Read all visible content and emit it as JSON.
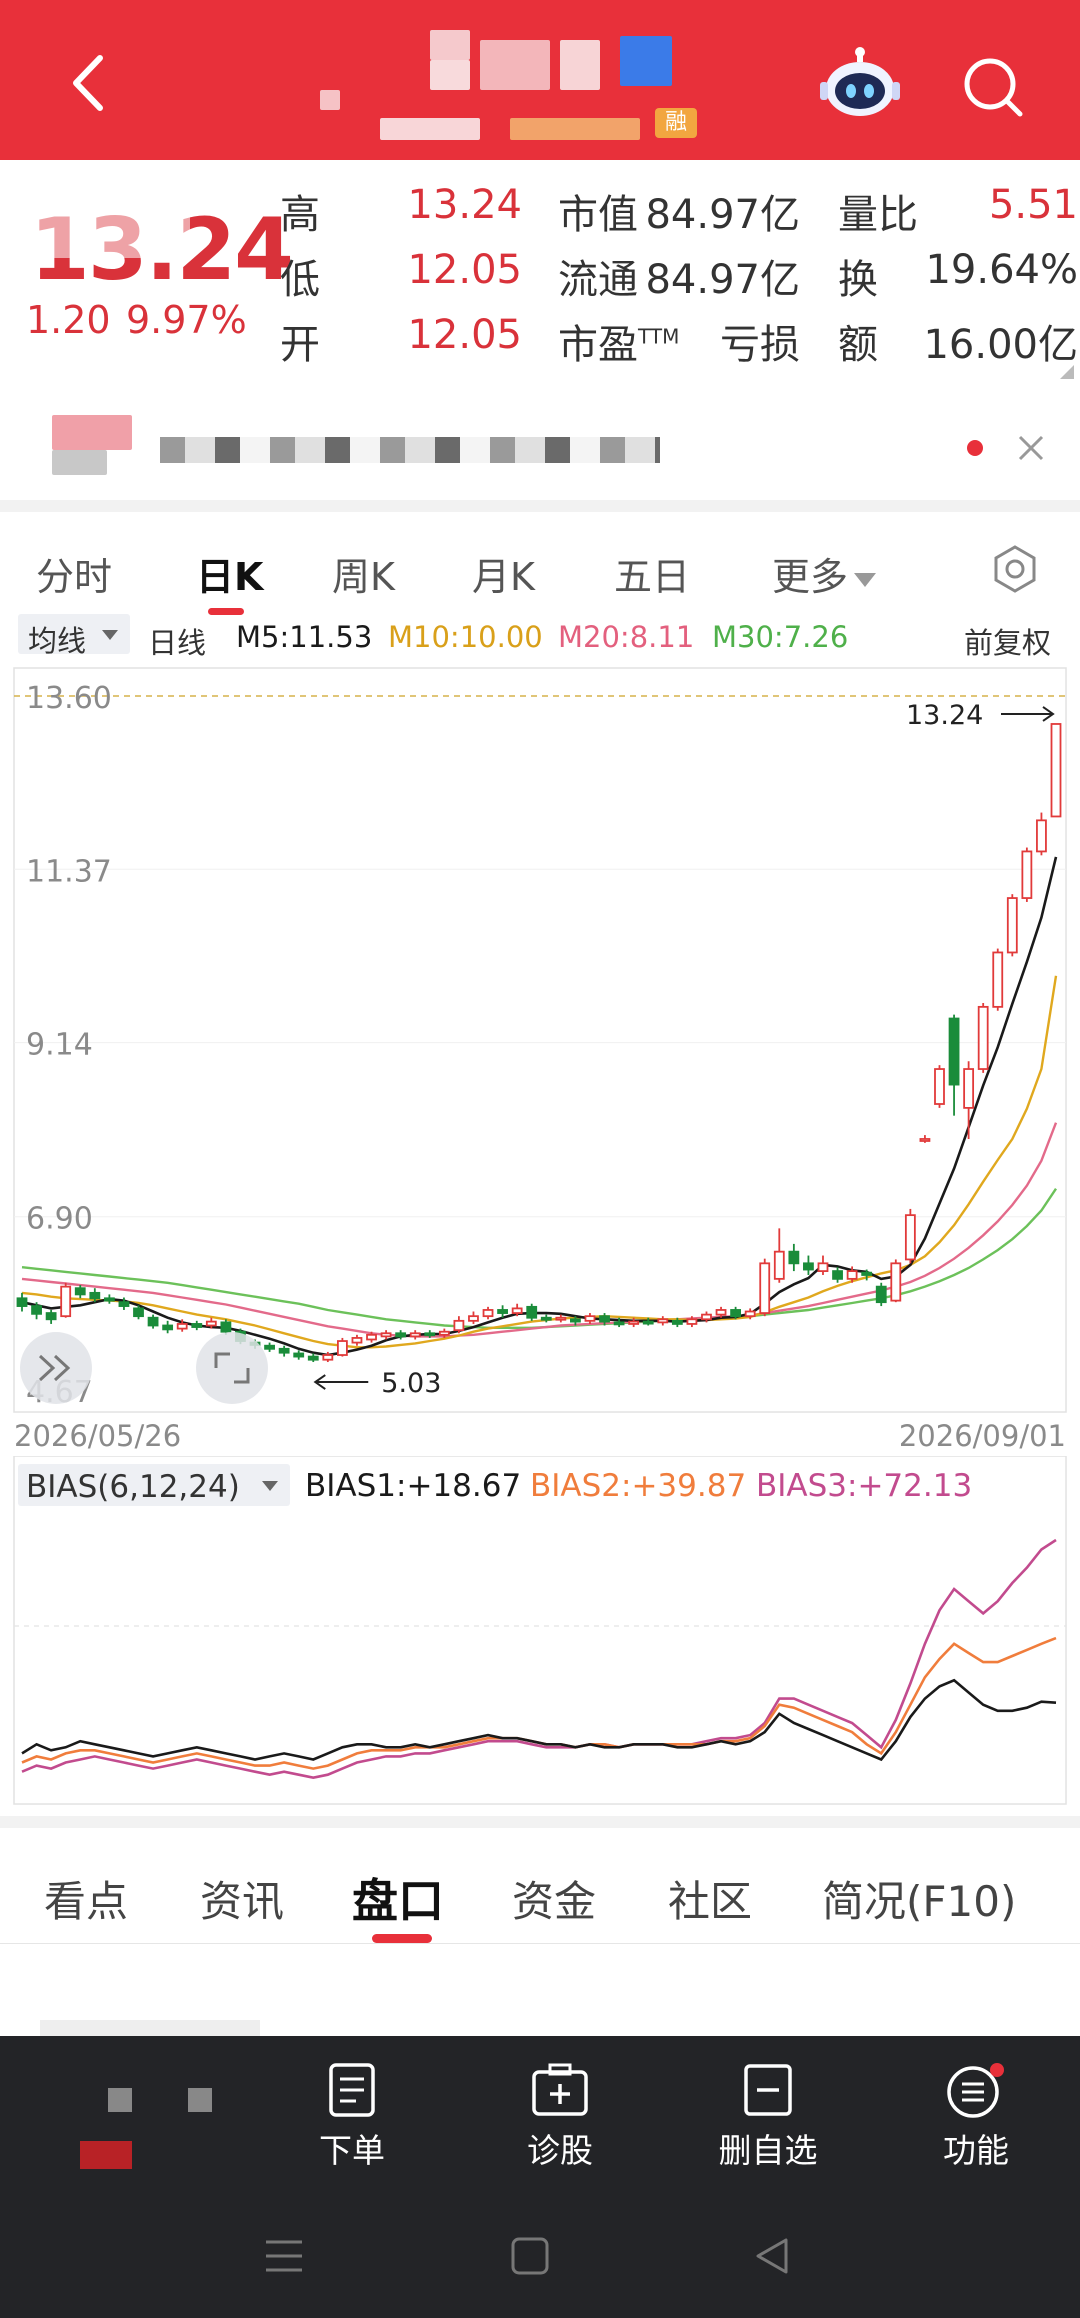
{
  "header": {
    "badge_label": "融",
    "colors": {
      "bg": "#e8303a"
    }
  },
  "quote": {
    "price": "13.24",
    "change": "1.20",
    "change_pct": "9.97%",
    "labels": {
      "high": "高",
      "low": "低",
      "open": "开",
      "mkt_cap": "市值",
      "float_cap": "流通",
      "pe": "市盈",
      "pe_sup": "TTM",
      "vol_ratio": "量比",
      "turnover": "换",
      "amount": "额"
    },
    "values": {
      "high": "13.24",
      "low": "12.05",
      "open": "12.05",
      "mkt_cap": "84.97亿",
      "float_cap": "84.97亿",
      "pe": "亏损",
      "vol_ratio": "5.51",
      "turnover": "19.64%",
      "amount": "16.00亿"
    }
  },
  "period_tabs": [
    "分时",
    "日K",
    "周K",
    "月K",
    "五日",
    "更多"
  ],
  "ma_bar": {
    "selector": "均线",
    "type": "日线",
    "m5": "M5:11.53",
    "m10": "M10:10.00",
    "m20": "M20:8.11",
    "m30": "M30:7.26",
    "adjust": "前复权"
  },
  "chart_data": [
    {
      "type": "candlestick",
      "title": "",
      "y_ticks": [
        "13.60",
        "11.37",
        "9.14",
        "6.90",
        "4.67"
      ],
      "ylim": [
        4.67,
        13.6
      ],
      "x_start_label": "2026/05/26",
      "x_end_label": "2026/09/01",
      "max_marker": "13.24",
      "min_marker": "5.03",
      "candles": [
        {
          "o": 5.85,
          "c": 5.75,
          "h": 5.92,
          "l": 5.68
        },
        {
          "o": 5.75,
          "c": 5.65,
          "h": 5.8,
          "l": 5.58
        },
        {
          "o": 5.66,
          "c": 5.58,
          "h": 5.7,
          "l": 5.52
        },
        {
          "o": 5.62,
          "c": 6.0,
          "h": 6.05,
          "l": 5.6
        },
        {
          "o": 5.98,
          "c": 5.9,
          "h": 6.02,
          "l": 5.85
        },
        {
          "o": 5.92,
          "c": 5.85,
          "h": 5.98,
          "l": 5.8
        },
        {
          "o": 5.85,
          "c": 5.82,
          "h": 5.9,
          "l": 5.78
        },
        {
          "o": 5.8,
          "c": 5.75,
          "h": 5.86,
          "l": 5.7
        },
        {
          "o": 5.72,
          "c": 5.62,
          "h": 5.76,
          "l": 5.58
        },
        {
          "o": 5.6,
          "c": 5.5,
          "h": 5.64,
          "l": 5.46
        },
        {
          "o": 5.5,
          "c": 5.45,
          "h": 5.56,
          "l": 5.4
        },
        {
          "o": 5.46,
          "c": 5.52,
          "h": 5.58,
          "l": 5.42
        },
        {
          "o": 5.52,
          "c": 5.48,
          "h": 5.56,
          "l": 5.44
        },
        {
          "o": 5.5,
          "c": 5.55,
          "h": 5.6,
          "l": 5.46
        },
        {
          "o": 5.54,
          "c": 5.42,
          "h": 5.58,
          "l": 5.38
        },
        {
          "o": 5.42,
          "c": 5.3,
          "h": 5.46,
          "l": 5.26
        },
        {
          "o": 5.28,
          "c": 5.25,
          "h": 5.32,
          "l": 5.2
        },
        {
          "o": 5.24,
          "c": 5.2,
          "h": 5.28,
          "l": 5.16
        },
        {
          "o": 5.2,
          "c": 5.15,
          "h": 5.24,
          "l": 5.1
        },
        {
          "o": 5.14,
          "c": 5.1,
          "h": 5.18,
          "l": 5.06
        },
        {
          "o": 5.1,
          "c": 5.06,
          "h": 5.14,
          "l": 5.03
        },
        {
          "o": 5.06,
          "c": 5.12,
          "h": 5.16,
          "l": 5.03
        },
        {
          "o": 5.12,
          "c": 5.3,
          "h": 5.34,
          "l": 5.1
        },
        {
          "o": 5.28,
          "c": 5.34,
          "h": 5.38,
          "l": 5.24
        },
        {
          "o": 5.32,
          "c": 5.38,
          "h": 5.42,
          "l": 5.28
        },
        {
          "o": 5.36,
          "c": 5.4,
          "h": 5.44,
          "l": 5.32
        },
        {
          "o": 5.4,
          "c": 5.36,
          "h": 5.44,
          "l": 5.32
        },
        {
          "o": 5.36,
          "c": 5.4,
          "h": 5.44,
          "l": 5.32
        },
        {
          "o": 5.4,
          "c": 5.38,
          "h": 5.44,
          "l": 5.34
        },
        {
          "o": 5.38,
          "c": 5.42,
          "h": 5.46,
          "l": 5.34
        },
        {
          "o": 5.44,
          "c": 5.56,
          "h": 5.62,
          "l": 5.4
        },
        {
          "o": 5.56,
          "c": 5.62,
          "h": 5.68,
          "l": 5.52
        },
        {
          "o": 5.62,
          "c": 5.7,
          "h": 5.74,
          "l": 5.58
        },
        {
          "o": 5.7,
          "c": 5.66,
          "h": 5.76,
          "l": 5.6
        },
        {
          "o": 5.66,
          "c": 5.72,
          "h": 5.78,
          "l": 5.62
        },
        {
          "o": 5.74,
          "c": 5.6,
          "h": 5.78,
          "l": 5.56
        },
        {
          "o": 5.6,
          "c": 5.58,
          "h": 5.64,
          "l": 5.54
        },
        {
          "o": 5.58,
          "c": 5.6,
          "h": 5.64,
          "l": 5.54
        },
        {
          "o": 5.58,
          "c": 5.55,
          "h": 5.62,
          "l": 5.5
        },
        {
          "o": 5.56,
          "c": 5.62,
          "h": 5.66,
          "l": 5.52
        },
        {
          "o": 5.62,
          "c": 5.55,
          "h": 5.66,
          "l": 5.5
        },
        {
          "o": 5.54,
          "c": 5.52,
          "h": 5.6,
          "l": 5.48
        },
        {
          "o": 5.52,
          "c": 5.55,
          "h": 5.6,
          "l": 5.48
        },
        {
          "o": 5.55,
          "c": 5.54,
          "h": 5.6,
          "l": 5.5
        },
        {
          "o": 5.54,
          "c": 5.58,
          "h": 5.62,
          "l": 5.5
        },
        {
          "o": 5.56,
          "c": 5.52,
          "h": 5.6,
          "l": 5.48
        },
        {
          "o": 5.52,
          "c": 5.58,
          "h": 5.62,
          "l": 5.48
        },
        {
          "o": 5.58,
          "c": 5.64,
          "h": 5.68,
          "l": 5.54
        },
        {
          "o": 5.64,
          "c": 5.7,
          "h": 5.74,
          "l": 5.6
        },
        {
          "o": 5.7,
          "c": 5.62,
          "h": 5.74,
          "l": 5.58
        },
        {
          "o": 5.62,
          "c": 5.68,
          "h": 5.72,
          "l": 5.58
        },
        {
          "o": 5.66,
          "c": 6.3,
          "h": 6.36,
          "l": 5.62
        },
        {
          "o": 6.1,
          "c": 6.45,
          "h": 6.75,
          "l": 6.05
        },
        {
          "o": 6.45,
          "c": 6.3,
          "h": 6.55,
          "l": 6.2
        },
        {
          "o": 6.3,
          "c": 6.22,
          "h": 6.4,
          "l": 6.15
        },
        {
          "o": 6.2,
          "c": 6.3,
          "h": 6.4,
          "l": 6.15
        },
        {
          "o": 6.2,
          "c": 6.1,
          "h": 6.25,
          "l": 6.05
        },
        {
          "o": 6.1,
          "c": 6.2,
          "h": 6.26,
          "l": 6.05
        },
        {
          "o": 6.18,
          "c": 6.15,
          "h": 6.22,
          "l": 6.08
        },
        {
          "o": 6.0,
          "c": 5.8,
          "h": 6.05,
          "l": 5.75
        },
        {
          "o": 5.82,
          "c": 6.3,
          "h": 6.35,
          "l": 5.8
        },
        {
          "o": 6.35,
          "c": 6.92,
          "h": 7.0,
          "l": 6.3
        },
        {
          "o": 7.9,
          "c": 7.9,
          "h": 7.95,
          "l": 7.85
        },
        {
          "o": 8.35,
          "c": 8.8,
          "h": 8.85,
          "l": 8.3
        },
        {
          "o": 9.45,
          "c": 8.6,
          "h": 9.5,
          "l": 8.2
        },
        {
          "o": 8.3,
          "c": 8.8,
          "h": 8.9,
          "l": 7.9
        },
        {
          "o": 8.8,
          "c": 9.6,
          "h": 9.65,
          "l": 8.75
        },
        {
          "o": 9.6,
          "c": 10.3,
          "h": 10.35,
          "l": 9.55
        },
        {
          "o": 10.3,
          "c": 11.0,
          "h": 11.05,
          "l": 10.25
        },
        {
          "o": 11.0,
          "c": 11.6,
          "h": 11.65,
          "l": 10.95
        },
        {
          "o": 11.6,
          "c": 12.0,
          "h": 12.1,
          "l": 11.55
        },
        {
          "o": 12.05,
          "c": 13.24,
          "h": 13.24,
          "l": 12.05
        }
      ],
      "ma": {
        "MA5": [
          5.8,
          5.76,
          5.72,
          5.74,
          5.76,
          5.8,
          5.84,
          5.82,
          5.76,
          5.68,
          5.6,
          5.54,
          5.5,
          5.48,
          5.47,
          5.43,
          5.38,
          5.33,
          5.27,
          5.2,
          5.15,
          5.12,
          5.15,
          5.19,
          5.24,
          5.31,
          5.36,
          5.38,
          5.39,
          5.39,
          5.43,
          5.48,
          5.54,
          5.6,
          5.65,
          5.66,
          5.66,
          5.65,
          5.62,
          5.59,
          5.58,
          5.57,
          5.56,
          5.56,
          5.56,
          5.55,
          5.56,
          5.57,
          5.6,
          5.61,
          5.65,
          5.78,
          5.93,
          6.03,
          6.11,
          6.28,
          6.26,
          6.21,
          6.19,
          6.1,
          6.13,
          6.28,
          6.62,
          7.07,
          7.52,
          8.05,
          8.59,
          9.08,
          9.64,
          10.18,
          10.75,
          11.53
        ],
        "MA10": [
          5.92,
          5.9,
          5.87,
          5.85,
          5.84,
          5.83,
          5.82,
          5.81,
          5.79,
          5.76,
          5.72,
          5.68,
          5.64,
          5.61,
          5.58,
          5.54,
          5.5,
          5.45,
          5.4,
          5.35,
          5.3,
          5.26,
          5.24,
          5.22,
          5.22,
          5.23,
          5.25,
          5.27,
          5.3,
          5.33,
          5.37,
          5.42,
          5.46,
          5.49,
          5.52,
          5.55,
          5.57,
          5.59,
          5.6,
          5.61,
          5.62,
          5.61,
          5.6,
          5.59,
          5.58,
          5.58,
          5.57,
          5.57,
          5.58,
          5.59,
          5.61,
          5.67,
          5.74,
          5.8,
          5.86,
          5.94,
          6.01,
          6.07,
          6.12,
          6.17,
          6.21,
          6.28,
          6.39,
          6.57,
          6.79,
          7.06,
          7.35,
          7.63,
          7.9,
          8.29,
          8.8,
          10.0
        ],
        "MA20": [
          6.1,
          6.08,
          6.06,
          6.04,
          6.02,
          6.0,
          5.98,
          5.96,
          5.94,
          5.92,
          5.89,
          5.86,
          5.83,
          5.8,
          5.77,
          5.73,
          5.69,
          5.65,
          5.61,
          5.57,
          5.53,
          5.49,
          5.46,
          5.43,
          5.4,
          5.38,
          5.37,
          5.36,
          5.36,
          5.36,
          5.37,
          5.38,
          5.4,
          5.42,
          5.44,
          5.46,
          5.48,
          5.5,
          5.51,
          5.52,
          5.53,
          5.54,
          5.55,
          5.56,
          5.57,
          5.58,
          5.59,
          5.6,
          5.61,
          5.62,
          5.63,
          5.66,
          5.69,
          5.72,
          5.75,
          5.79,
          5.83,
          5.87,
          5.91,
          5.95,
          6.0,
          6.06,
          6.14,
          6.24,
          6.36,
          6.5,
          6.66,
          6.84,
          7.05,
          7.3,
          7.62,
          8.11
        ],
        "MA30": [
          6.25,
          6.23,
          6.21,
          6.19,
          6.17,
          6.15,
          6.13,
          6.11,
          6.09,
          6.07,
          6.05,
          6.02,
          5.99,
          5.96,
          5.93,
          5.9,
          5.87,
          5.84,
          5.81,
          5.78,
          5.74,
          5.7,
          5.67,
          5.64,
          5.61,
          5.58,
          5.56,
          5.54,
          5.52,
          5.5,
          5.49,
          5.48,
          5.47,
          5.47,
          5.47,
          5.47,
          5.48,
          5.49,
          5.5,
          5.51,
          5.52,
          5.53,
          5.54,
          5.55,
          5.56,
          5.57,
          5.58,
          5.59,
          5.6,
          5.61,
          5.62,
          5.64,
          5.66,
          5.68,
          5.7,
          5.73,
          5.76,
          5.79,
          5.82,
          5.85,
          5.89,
          5.94,
          6.0,
          6.07,
          6.15,
          6.24,
          6.35,
          6.47,
          6.61,
          6.78,
          6.98,
          7.26
        ]
      },
      "colors": {
        "up": "#e13a3a",
        "down": "#1a8c3a",
        "MA5": "#1a1a1a",
        "MA10": "#e0a81e",
        "MA20": "#e36a8a",
        "MA30": "#6cc15a"
      }
    },
    {
      "type": "line",
      "title": "",
      "selector": "BIAS(6,12,24)",
      "bias1": "BIAS1:+18.67",
      "bias2": "BIAS2:+39.87",
      "bias3": "BIAS3:+72.13",
      "ylim": [
        -12,
        80
      ],
      "series": [
        {
          "name": "BIAS1",
          "color": "#1a1a1a",
          "values": [
            2,
            5,
            3,
            4,
            6,
            5,
            4,
            3,
            2,
            1,
            2,
            3,
            4,
            3,
            2,
            1,
            0,
            1,
            2,
            1,
            0,
            2,
            4,
            5,
            5,
            4,
            4,
            5,
            4,
            5,
            6,
            7,
            8,
            7,
            7,
            6,
            5,
            5,
            4,
            5,
            4,
            4,
            5,
            5,
            5,
            4,
            4,
            5,
            6,
            5,
            6,
            9,
            15,
            12,
            10,
            8,
            6,
            4,
            2,
            0,
            6,
            14,
            20,
            24,
            26,
            22,
            18,
            16,
            16,
            17,
            19,
            18.67
          ]
        },
        {
          "name": "BIAS2",
          "color": "#f07d3c",
          "values": [
            -1,
            1,
            0,
            2,
            3,
            3,
            2,
            1,
            0,
            -1,
            0,
            1,
            2,
            1,
            0,
            -1,
            -2,
            -2,
            -1,
            -2,
            -3,
            -2,
            0,
            2,
            3,
            3,
            3,
            4,
            4,
            4,
            5,
            6,
            7,
            7,
            7,
            6,
            5,
            5,
            4,
            5,
            5,
            4,
            5,
            5,
            5,
            5,
            5,
            5,
            6,
            6,
            7,
            11,
            18,
            17,
            15,
            13,
            11,
            9,
            5,
            2,
            9,
            18,
            27,
            33,
            38,
            35,
            32,
            32,
            34,
            36,
            38,
            39.87
          ]
        },
        {
          "name": "BIAS3",
          "color": "#c24b8e",
          "values": [
            -4,
            -2,
            -3,
            -1,
            0,
            1,
            0,
            -1,
            -2,
            -3,
            -2,
            -1,
            0,
            -1,
            -2,
            -3,
            -4,
            -5,
            -4,
            -5,
            -6,
            -5,
            -3,
            -1,
            0,
            1,
            1,
            2,
            2,
            3,
            4,
            5,
            6,
            6,
            6,
            5,
            4,
            4,
            4,
            5,
            5,
            4,
            5,
            5,
            5,
            5,
            5,
            6,
            7,
            7,
            8,
            12,
            20,
            20,
            18,
            16,
            14,
            12,
            8,
            4,
            13,
            25,
            38,
            49,
            56,
            52,
            48,
            52,
            58,
            63,
            69,
            72.13
          ]
        }
      ]
    }
  ],
  "bottom_tabs": [
    "看点",
    "资讯",
    "盘口",
    "资金",
    "社区",
    "简况(F10)"
  ],
  "dock": [
    "下单",
    "诊股",
    "删自选",
    "功能"
  ]
}
